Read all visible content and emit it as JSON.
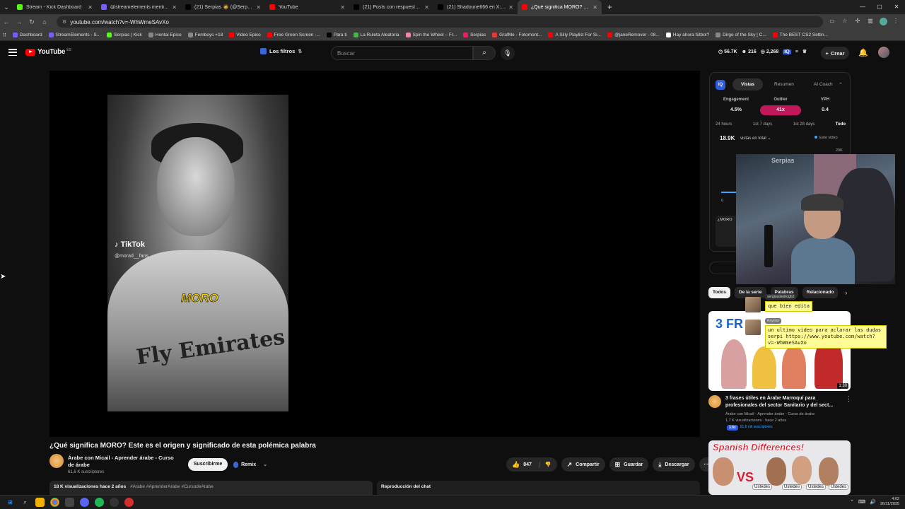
{
  "browser": {
    "tabs": [
      {
        "title": "Stream - Kick Dashboard",
        "color": "#53fc18"
      },
      {
        "title": "@streamelements mention",
        "color": "#7b5cff"
      },
      {
        "title": "(21) Serpias 🧔 (@Serpias) / X",
        "color": "#000000"
      },
      {
        "title": "YouTube",
        "color": "#ff0000"
      },
      {
        "title": "(21) Posts con respuestas de Se",
        "color": "#000000"
      },
      {
        "title": "(21) Shadoune666 en X: \"Que s",
        "color": "#000000"
      },
      {
        "title": "¿Qué significa MORO? Este",
        "color": "#ff0000",
        "active": true
      }
    ],
    "url": "youtube.com/watch?v=-WhWmeSAvXo",
    "bookmarks": [
      {
        "label": "Dashboard",
        "color": "#7b5cff"
      },
      {
        "label": "StreamElements - S...",
        "color": "#7b5cff"
      },
      {
        "label": "Serpias | Kick",
        "color": "#53fc18"
      },
      {
        "label": "Hentai Epico",
        "color": "#888888"
      },
      {
        "label": "Femboys +18",
        "color": "#888888"
      },
      {
        "label": "Video Epico",
        "color": "#ff0000"
      },
      {
        "label": "Free Green Screen -...",
        "color": "#ff0000"
      },
      {
        "label": "Para ti",
        "color": "#000000"
      },
      {
        "label": "La Ruleta Aleatoria",
        "color": "#4caf50"
      },
      {
        "label": "Spin the Wheel – Fr...",
        "color": "#e8a"
      },
      {
        "label": "Serpias",
        "color": "#e91e63"
      },
      {
        "label": "GrafMe - Fotomont...",
        "color": "#e53935"
      },
      {
        "label": "A Silly Playlist For Si...",
        "color": "#ff0000"
      },
      {
        "label": "@janeRemover - 08...",
        "color": "#ff0000"
      },
      {
        "label": "Hay ahora fútbol?",
        "color": "#ffffff"
      },
      {
        "label": "Dirge of the Sky | C...",
        "color": "#888888"
      },
      {
        "label": "The BEST CS2 Settin...",
        "color": "#ff0000"
      }
    ]
  },
  "youtube": {
    "logo": "YouTube",
    "logo_cc": "ES",
    "filters_label": "Los filtros",
    "search_placeholder": "Buscar",
    "stats": [
      "56.7K",
      "216",
      "2,268"
    ],
    "create_label": "Crear"
  },
  "video": {
    "tiktok_label": "TikTok",
    "tiktok_handle": "@morad__fans",
    "caption": "MORO",
    "shirt_text": "Fly Emirates",
    "title": "¿Qué significa MORO? Este es el origen y significado de esta polémica palabra",
    "channel": "Árabe con Micail - Aprender árabe - Curso de árabe",
    "subscribers": "61,6 K suscriptores",
    "subscribe_label": "Suscribirme",
    "remix_label": "Remix",
    "likes": "847",
    "share_label": "Compartir",
    "save_label": "Guardar",
    "download_label": "Descargar",
    "views_line": "18 K visualizaciones  hace 2 años",
    "hashtags": "#Arabe #AprenderArabe #CursodeArabe",
    "chat_replay": "Reproducción del chat"
  },
  "vidiq": {
    "logo": "IQ",
    "tabs": [
      "Vistas",
      "Resumen",
      "AI Coach"
    ],
    "metrics": [
      {
        "label": "Engagement",
        "value": "4.5%"
      },
      {
        "label": "Outlier",
        "value": "41x"
      },
      {
        "label": "VPH",
        "value": "0.4"
      }
    ],
    "periods": [
      "24 hours",
      "1st 7 days",
      "1st 28 days",
      "Todo"
    ],
    "views_total": "18.9K",
    "views_label": "vistas en total",
    "este_video": "Este video",
    "y_max": "20K",
    "y_min": "0",
    "card_text": "¿MORO"
  },
  "chips": [
    "Todos",
    "De la serie",
    "Palabras",
    "Relacionado"
  ],
  "recommendations": [
    {
      "thumb_text": "3 FR",
      "duration": "1:30",
      "title": "3 frases útiles en Árabe Marroquí para profesionales del sector Sanitario y del sect...",
      "channel": "Árabe con Micail - Aprender árabe - Curso de árabe",
      "views": "1,7 K visualizaciones · hace 2 años",
      "badge1": "3.8x",
      "badge2": "61.6 mil suscriptores"
    },
    {
      "thumb_text": "Spanish Differences!",
      "vs": "VS",
      "ustedes": [
        "Ustedes",
        "Ustedes",
        "Ustedes",
        "Ustedes"
      ]
    }
  ],
  "webcam": {
    "banner": "Serpias"
  },
  "chat": [
    {
      "user": "sergiosoledrogh2",
      "message": "que bien edita"
    },
    {
      "user": "Ruyolor",
      "message": "un ultimo video para aclarar las dudas serpi https://www.youtube.com/watch?v=-WhWmeSAvXo"
    }
  ],
  "taskbar": {
    "time": "4:02",
    "date": "26/11/2025"
  }
}
